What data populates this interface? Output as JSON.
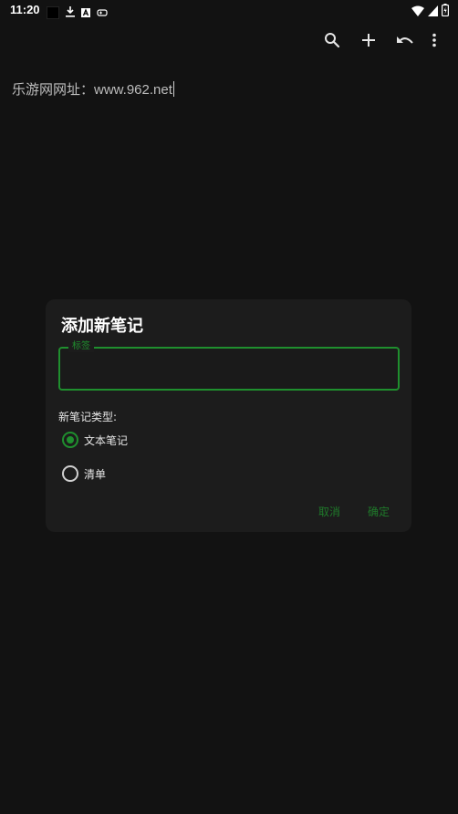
{
  "status_bar": {
    "time": "11:20",
    "left_icons": [
      "notification-square-icon",
      "download-icon",
      "app-a-icon",
      "gamepad-icon"
    ],
    "right_icons": [
      "wifi-icon",
      "signal-icon",
      "battery-icon"
    ]
  },
  "toolbar": {
    "icons": [
      "search-icon",
      "add-icon",
      "undo-icon",
      "more-vert-icon"
    ]
  },
  "note": {
    "content": "乐游网网址：www.962.net"
  },
  "dialog": {
    "title": "添加新笔记",
    "field_label": "标签",
    "field_value": "",
    "type_label": "新笔记类型:",
    "options": [
      {
        "label": "文本笔记",
        "selected": true
      },
      {
        "label": "清单",
        "selected": false
      }
    ],
    "cancel_label": "取消",
    "ok_label": "确定"
  },
  "colors": {
    "background": "#121212",
    "dialog": "#1c1c1c",
    "accent": "#1f8f2e"
  }
}
